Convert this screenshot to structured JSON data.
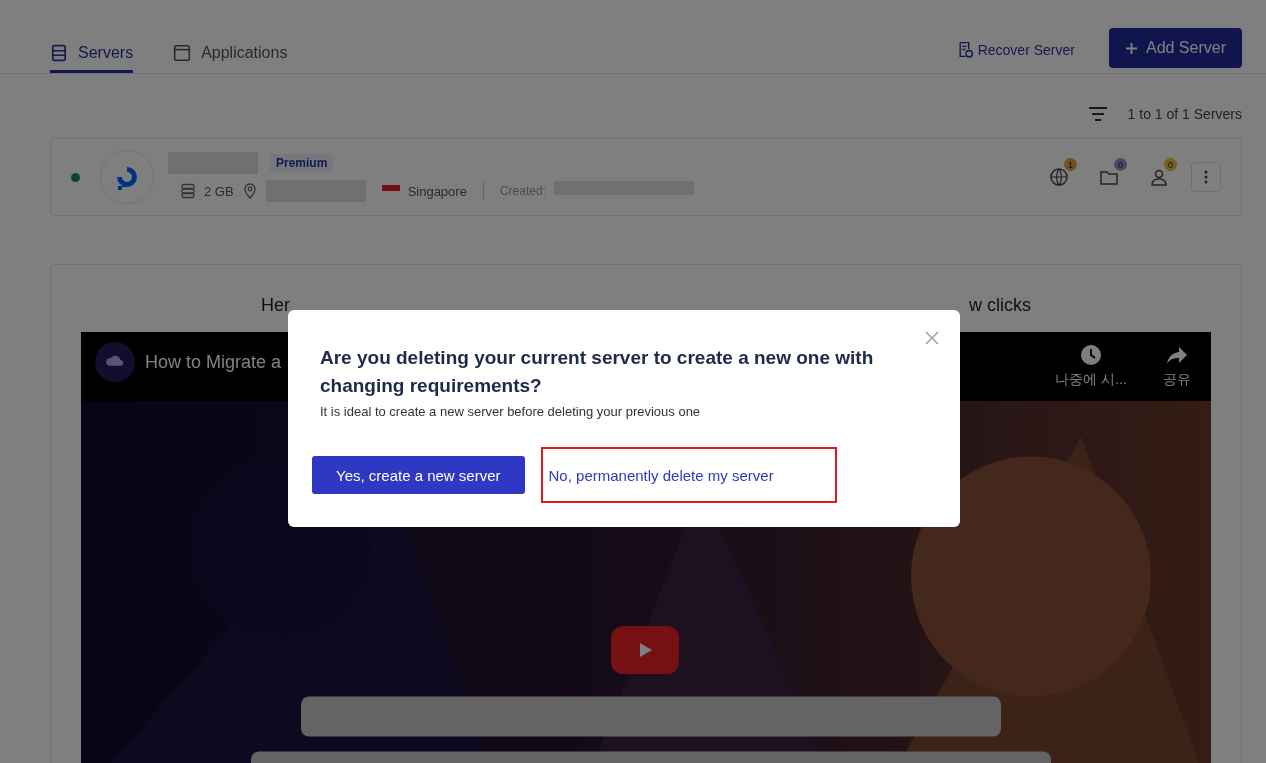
{
  "header": {
    "recover_button": "Recover Server",
    "add_button": "Add Server"
  },
  "tabs": [
    {
      "label": "Servers",
      "selected": true
    },
    {
      "label": "Applications",
      "selected": false
    }
  ],
  "list_summary": "1 to 1 of 1 Servers",
  "server": {
    "online": true,
    "plan": "Premium",
    "memory": "2 GB",
    "location": "Singapore",
    "created_label": "Created:",
    "counters": [
      {
        "count": "1"
      },
      {
        "count": "0"
      },
      {
        "count": "0"
      }
    ]
  },
  "panel": {
    "heading_start": "Her",
    "heading_end": "w clicks",
    "video": {
      "title": "How to Migrate a",
      "actions": [
        {
          "label": "나중에 시..."
        },
        {
          "label": "공유"
        }
      ]
    }
  },
  "dialog": {
    "title": "Are you deleting your current server to create a new one with changing requirements?",
    "subtitle": "It is ideal to create a new server before deleting your previous one",
    "primary_button": "Yes, create a new server",
    "secondary_link": "No, permanently delete my server",
    "secondary_highlighted": true
  }
}
